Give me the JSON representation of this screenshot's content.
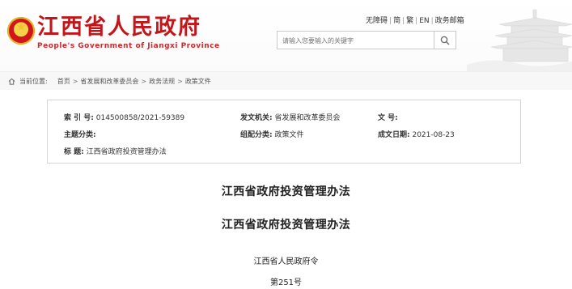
{
  "header": {
    "title": "江西省人民政府",
    "subtitle": "People's Government of Jiangxi Province",
    "links": [
      "无障碍",
      "简",
      "繁",
      "EN",
      "政务邮箱"
    ],
    "search_placeholder": "请输入您要输入的关键字"
  },
  "breadcrumb": {
    "label": "当前位置:",
    "items": [
      "首页",
      "省发展和改革委员会",
      "政务法规",
      "政策文件"
    ]
  },
  "meta": {
    "index_label": "索  引  号:",
    "index_value": "014500858/2021-59389",
    "issuer_label": "发文机关:",
    "issuer_value": "省发展和改革委员会",
    "docno_label": "文      号:",
    "docno_value": "",
    "topic_label": "主题分类:",
    "topic_value": "",
    "category_label": "组配分类:",
    "category_value": "政策文件",
    "date_label": "成文日期:",
    "date_value": "2021-08-23",
    "title_label": "标      题:",
    "title_value": "江西省政府投资管理办法"
  },
  "document": {
    "title": "江西省政府投资管理办法",
    "subtitle": "江西省政府投资管理办法",
    "order": "江西省人民政府令",
    "number": "第251号"
  }
}
